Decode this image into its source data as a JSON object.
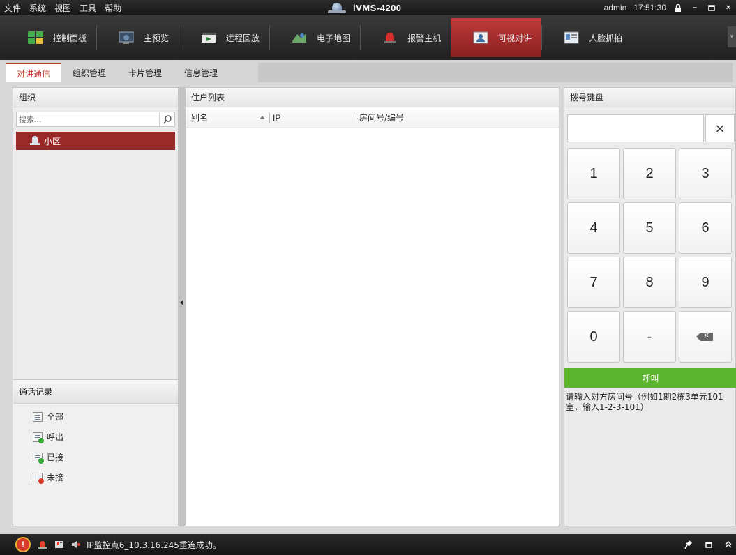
{
  "menu": [
    "文件",
    "系统",
    "视图",
    "工具",
    "帮助"
  ],
  "app": {
    "name": "iVMS-4200"
  },
  "user": {
    "name": "admin",
    "time": "17:51:30"
  },
  "window_controls": {
    "lock": "lock-icon",
    "minimize": "–",
    "maximize": "▫",
    "close": "×"
  },
  "modules": [
    {
      "label": "控制面板",
      "icon": "control-panel-icon",
      "color": "#3fa84a"
    },
    {
      "label": "主预览",
      "icon": "main-view-icon",
      "color": "#4a6b88"
    },
    {
      "label": "远程回放",
      "icon": "playback-icon",
      "color": "#5a7a5a"
    },
    {
      "label": "电子地图",
      "icon": "map-icon",
      "color": "#5a9a5a"
    },
    {
      "label": "报警主机",
      "icon": "alarm-host-icon",
      "color": "#c0392b"
    },
    {
      "label": "可视对讲",
      "icon": "video-intercom-icon",
      "color": "#3a6ea5"
    },
    {
      "label": "人脸抓拍",
      "icon": "face-capture-icon",
      "color": "#5b8cc8"
    }
  ],
  "active_module": "可视对讲",
  "subtabs": [
    "对讲通信",
    "组织管理",
    "卡片管理",
    "信息管理"
  ],
  "active_subtab": "对讲通信",
  "organization": {
    "title": "组织",
    "search_placeholder": "搜索...",
    "tree": [
      {
        "label": "小区",
        "selected": true
      }
    ]
  },
  "call_records": {
    "title": "通话记录",
    "items": [
      {
        "label": "全部",
        "icon": "all-records-icon",
        "dot": ""
      },
      {
        "label": "呼出",
        "icon": "outgoing-call-icon",
        "dot": "#3aa83a"
      },
      {
        "label": "已接",
        "icon": "received-call-icon",
        "dot": "#3aa83a"
      },
      {
        "label": "未接",
        "icon": "missed-call-icon",
        "dot": "#d63a2a"
      }
    ]
  },
  "resident_list": {
    "title": "住户列表",
    "columns": [
      "别名",
      "IP",
      "房间号/编号"
    ],
    "rows": []
  },
  "dial_pad": {
    "title": "拨号键盘",
    "display_value": "",
    "clear_label": "×",
    "keys": [
      "1",
      "2",
      "3",
      "4",
      "5",
      "6",
      "7",
      "8",
      "9",
      "0",
      "-"
    ],
    "call_label": "呼叫",
    "hint": "请输入对方房间号（例如1期2栋3单元101室，输入1-2-3-101）"
  },
  "status_bar": {
    "message": "IP监控点6_10.3.16.245重连成功。"
  },
  "colors": {
    "accent_red": "#9a2a2a",
    "call_green": "#5cb52f",
    "active_tab": "#c0392b"
  }
}
